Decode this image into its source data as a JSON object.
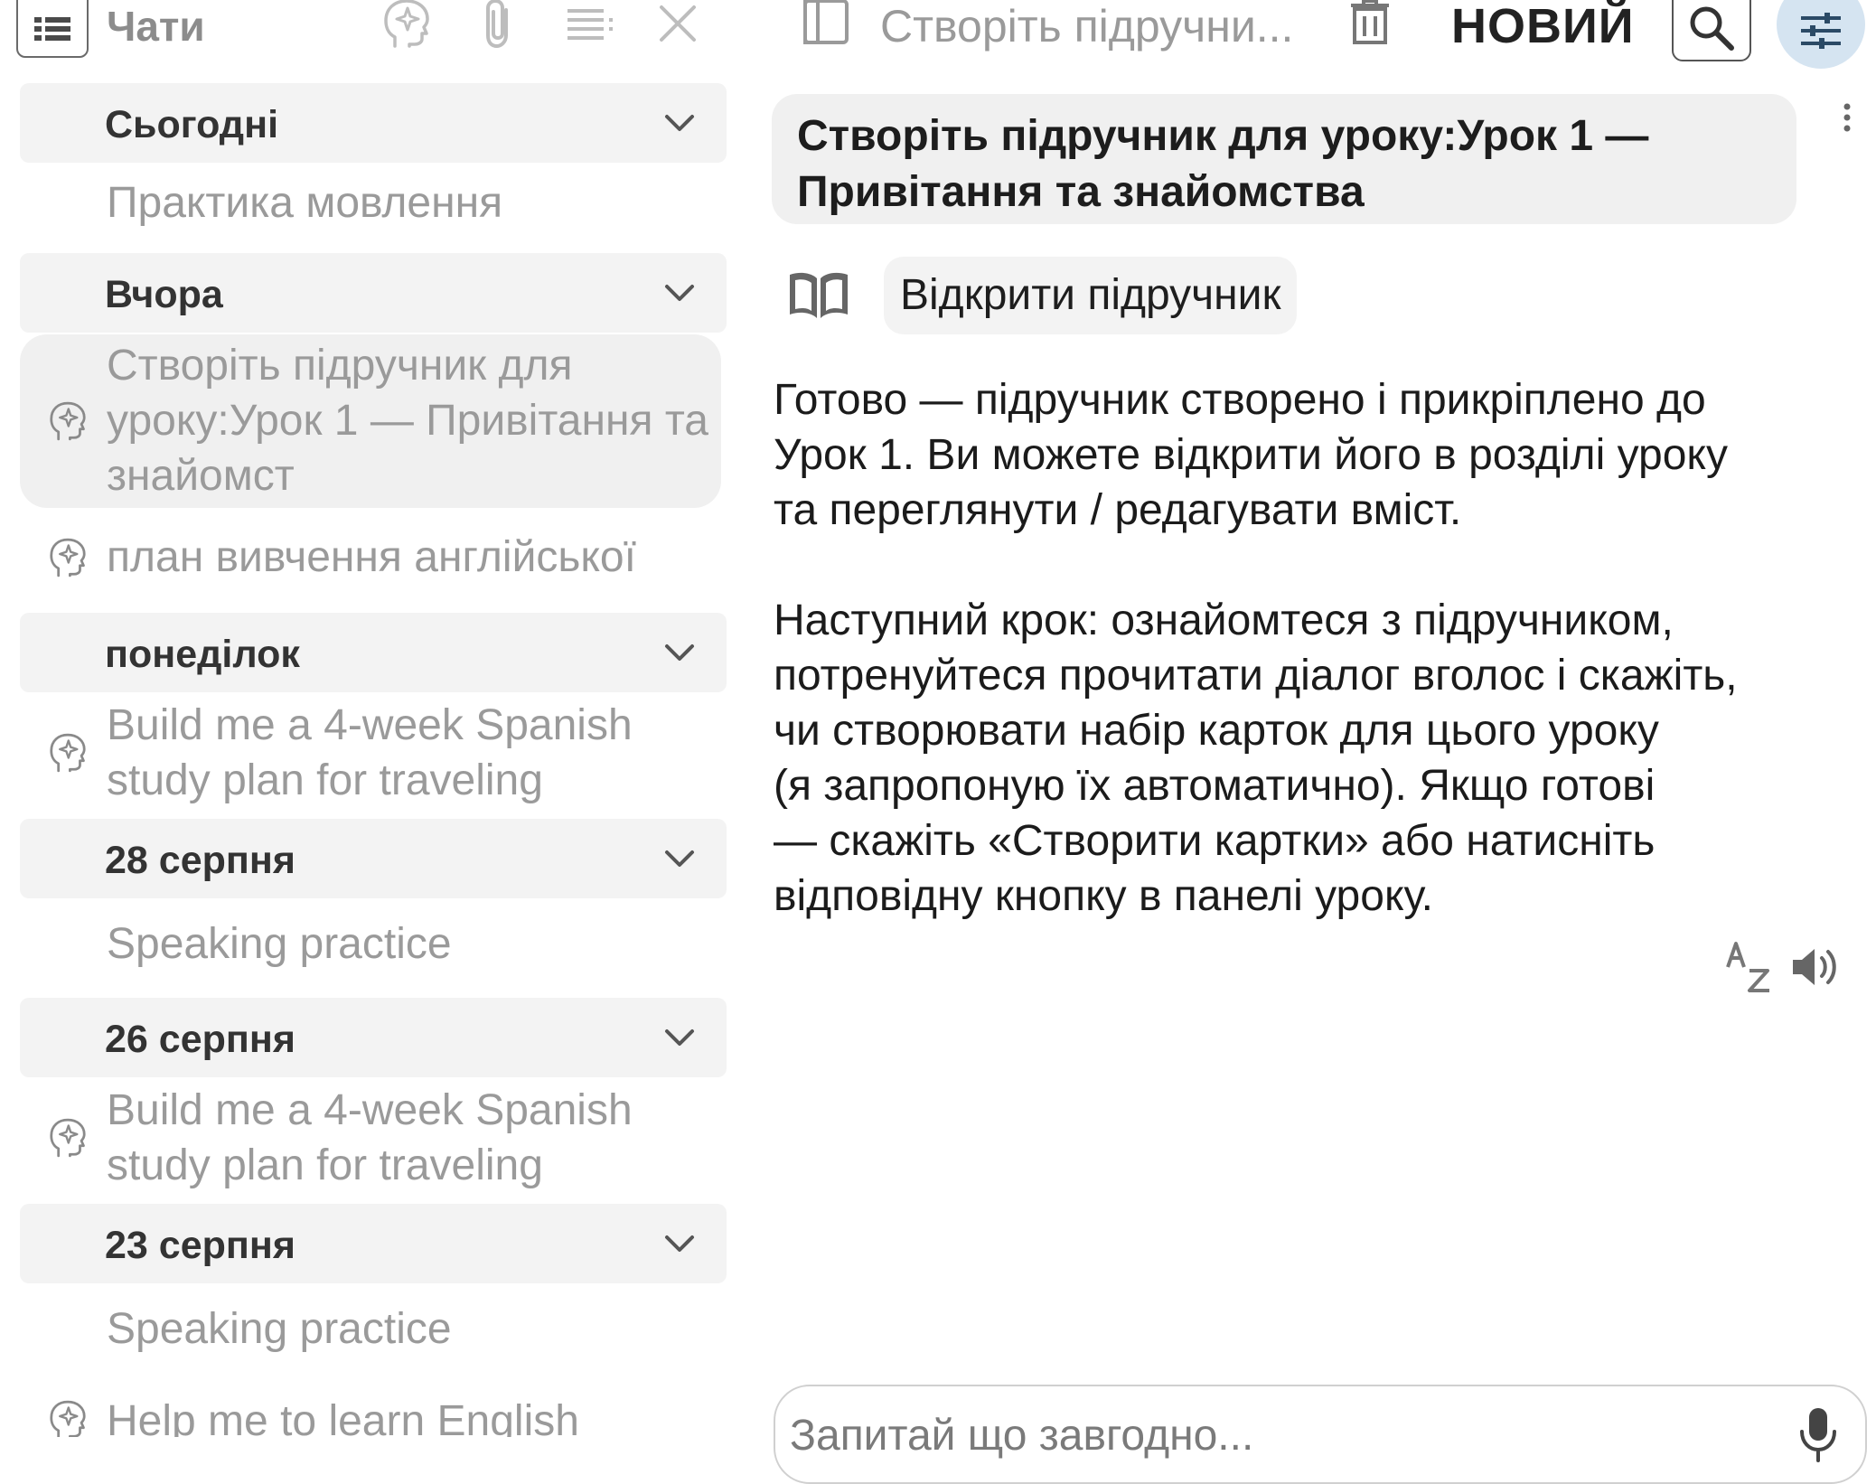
{
  "sidebar": {
    "title": "Чати",
    "groups": [
      {
        "label": "Сьогодні",
        "items": [
          {
            "title": "Практика мовлення",
            "ai": false
          }
        ]
      },
      {
        "label": "Вчора",
        "items": [
          {
            "title": "Створіть підручник для уроку:Урок 1 — Привітання та знайомст",
            "ai": true,
            "selected": true
          },
          {
            "title": "план вивчення англійської",
            "ai": true
          }
        ]
      },
      {
        "label": "понеділок",
        "items": [
          {
            "title": "Build me a 4-week Spanish study plan for traveling",
            "ai": true
          }
        ]
      },
      {
        "label": "28 серпня",
        "items": [
          {
            "title": "Speaking practice",
            "ai": false
          }
        ]
      },
      {
        "label": "26 серпня",
        "items": [
          {
            "title": "Build me a 4-week Spanish study plan for traveling",
            "ai": true
          }
        ]
      },
      {
        "label": "23 серпня",
        "items": [
          {
            "title": "Speaking practice",
            "ai": false
          },
          {
            "title": "Help me to learn English",
            "ai": true
          }
        ]
      }
    ]
  },
  "main": {
    "toolbar": {
      "title": "Створіть підручни...",
      "new_label": "НОВИЙ"
    },
    "user_message": "Створіть підручник для уроку:Урок 1 — Привітання та знайомства",
    "open_book_label": "Відкрити підручник",
    "answer_paragraphs": [
      "Готово — підручник створено і прикріплено до\nУрок 1. Ви можете відкрити його в розділі уроку\nта переглянути / редагувати вміст.",
      "Наступний крок: ознайомтеся з підручником,\nпотренуйтеся прочитати діалог вголос і скажіть,\nчи створювати набір карток для цього уроку\n(я запропоную їх автоматично). Якщо готові\n— скажіть «Створити картки» або натисніть\nвідповідну кнопку в панелі уроку."
    ],
    "input_placeholder": "Запитай що завгодно..."
  },
  "colors": {
    "background": "#ffffff",
    "group_header_bg": "#f3f3f3",
    "bubble_bg": "#f0f0f0",
    "accent_settings_bg": "#d5e4f1",
    "muted_text": "#9a9a9a"
  },
  "icons": {
    "sidebar_toggle": "list-icon",
    "ai_chat": "brain-sparkle-icon",
    "attach": "paperclip-icon",
    "filter": "filter-lines-icon",
    "close": "close-icon",
    "panel": "panel-icon",
    "trash": "trash-icon",
    "search": "search-icon",
    "settings": "sliders-icon",
    "book": "book-icon",
    "translate": "translate-icon",
    "speak": "speaker-icon",
    "mic": "mic-icon"
  }
}
